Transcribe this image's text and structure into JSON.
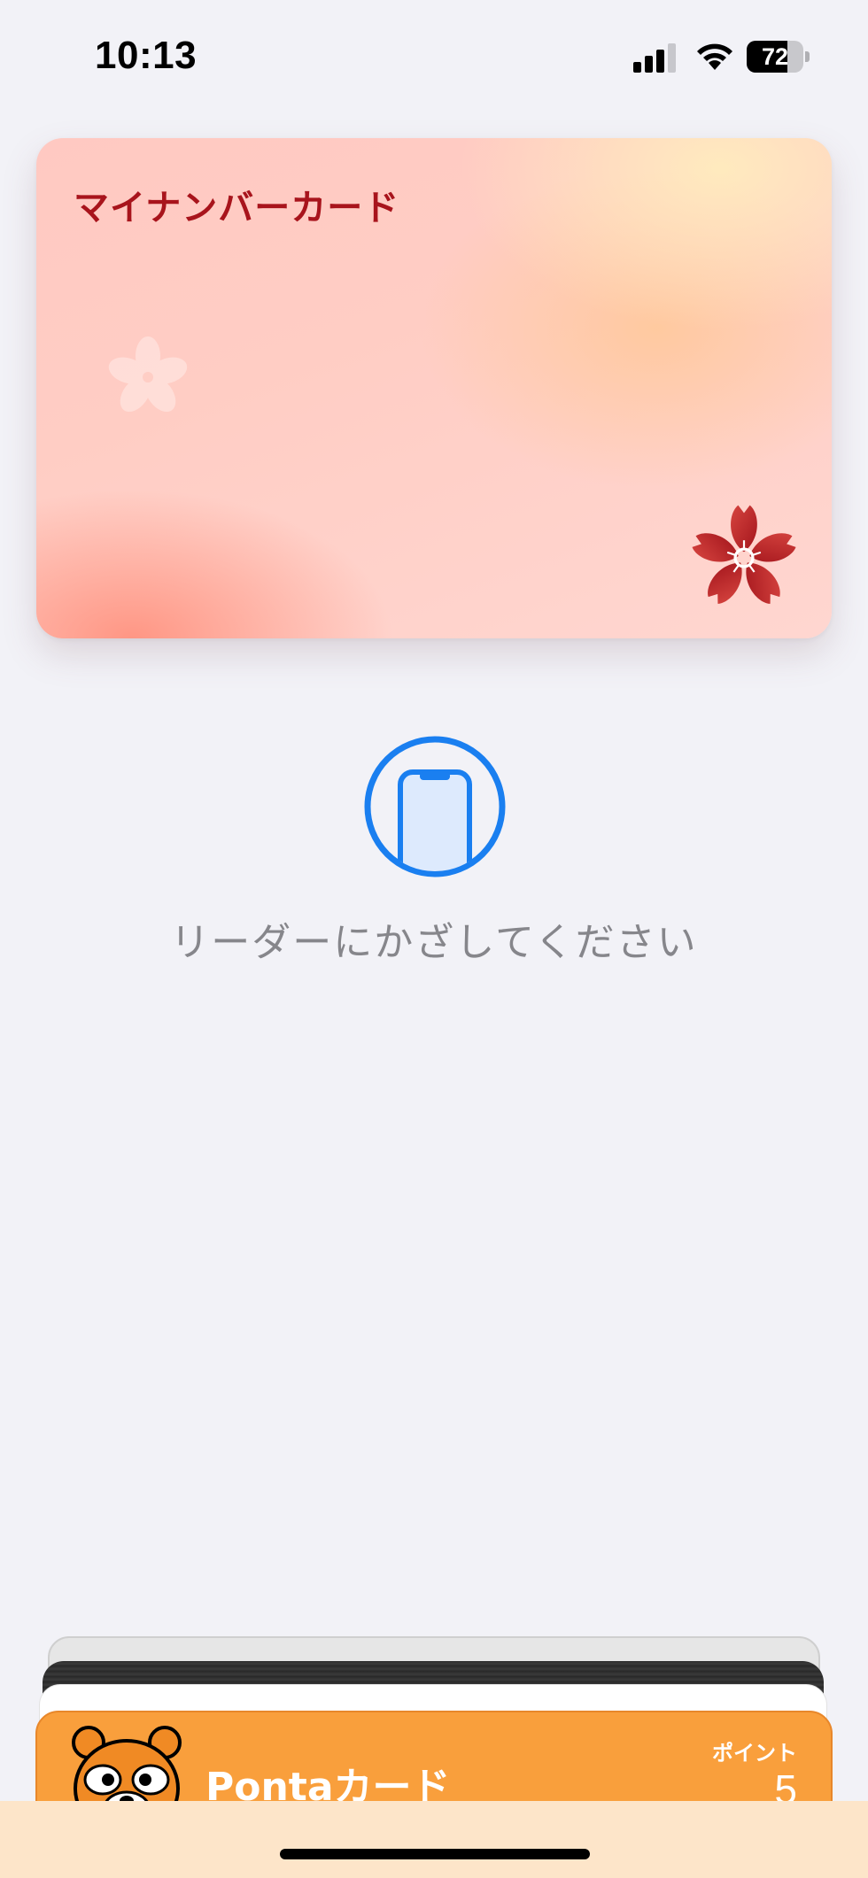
{
  "status_bar": {
    "time": "10:13",
    "battery_level": "72",
    "battery_percent": 72,
    "signal_bars_active": 3,
    "signal_bars_total": 4
  },
  "main_card": {
    "title": "マイナンバーカード",
    "title_color": "#a8141c",
    "icon": "sakura-icon"
  },
  "prompt": {
    "icon": "nfc-phone-icon",
    "text": "リーダーにかざしてください",
    "accent_color": "#1a7ff0"
  },
  "wallet_stack": {
    "cards": [
      {
        "name": "stack-card-gray"
      },
      {
        "name": "stack-card-black"
      },
      {
        "name": "stack-card-white"
      }
    ],
    "front_card": {
      "name": "Pontaカード",
      "points_label": "ポイント",
      "points_value": "5",
      "color": "#f99f3c",
      "icon": "ponta-mascot-icon"
    }
  }
}
